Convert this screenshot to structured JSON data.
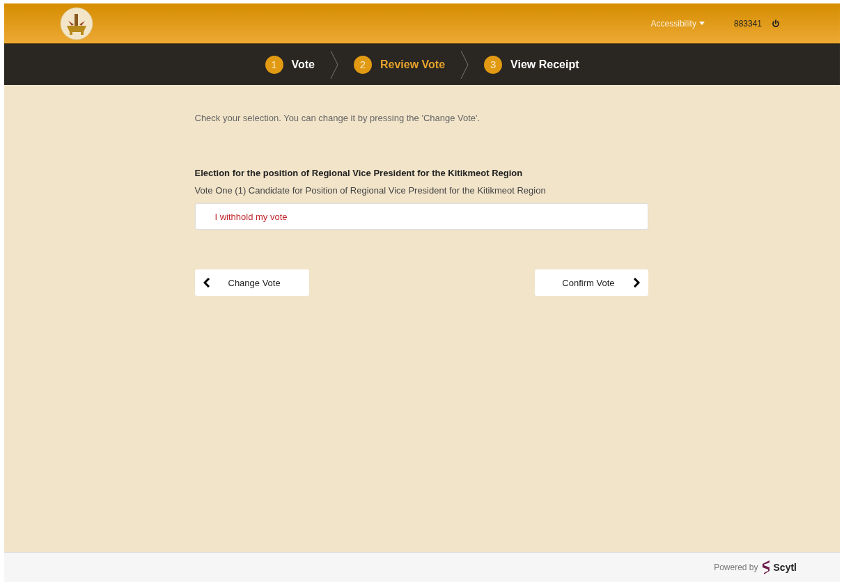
{
  "header": {
    "accessibility": "Accessibility",
    "user_id": "883341"
  },
  "steps": [
    {
      "number": "1",
      "label": "Vote",
      "selected": false
    },
    {
      "number": "2",
      "label": "Review Vote",
      "selected": true
    },
    {
      "number": "3",
      "label": "View Receipt",
      "selected": false
    }
  ],
  "instructions": "Check your selection. You can change it by pressing the 'Change Vote'.",
  "contest": {
    "title": "Election for the position of Regional Vice President for the Kitikmeot Region",
    "subtitle": "Vote One (1) Candidate for Position of Regional Vice President for the Kitikmeot Region",
    "selections": [
      "I withhold my vote"
    ]
  },
  "buttons": {
    "back": "Change Vote",
    "next": "Confirm Vote"
  },
  "footer": {
    "powered_by": "Powered by",
    "brand": "Scytl"
  }
}
